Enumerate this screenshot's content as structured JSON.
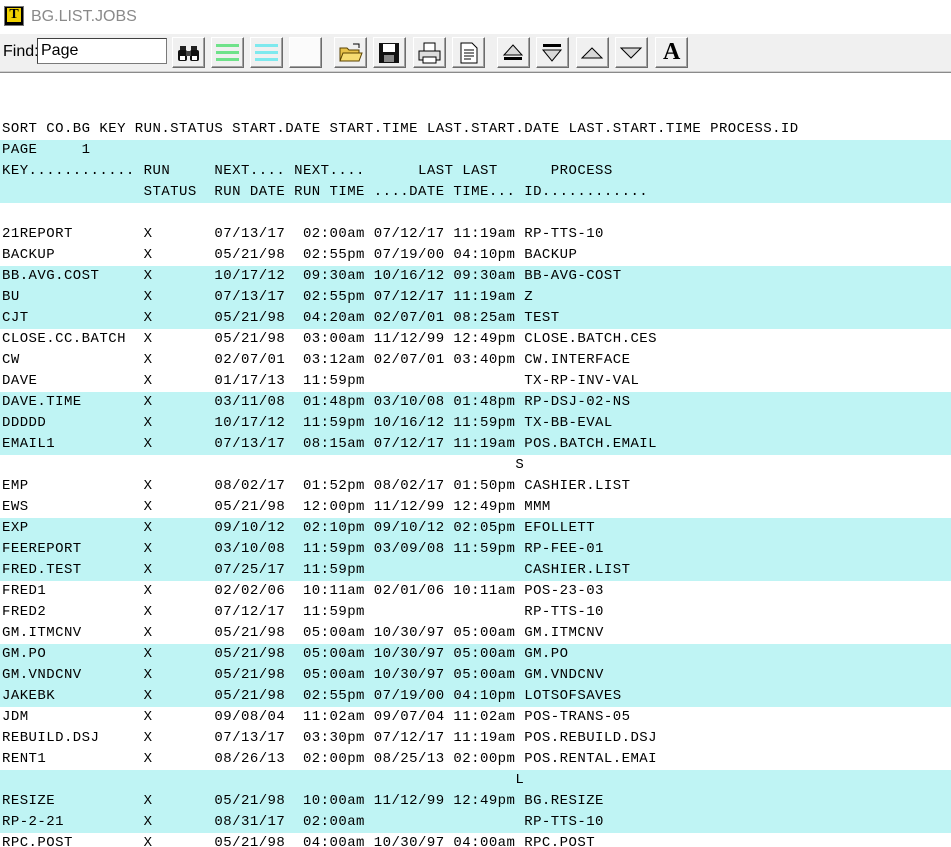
{
  "window": {
    "title": "BG.LIST.JOBS"
  },
  "toolbar": {
    "find_label": "Find:",
    "find_value": "Page",
    "buttons": [
      {
        "name": "binoculars-icon"
      },
      {
        "name": "green-lines-icon",
        "color": "#6fe28a"
      },
      {
        "name": "cyan-lines-icon",
        "color": "#7ee9ee"
      },
      {
        "name": "blank-icon"
      },
      {
        "name": "open-folder-icon"
      },
      {
        "name": "save-disk-icon"
      },
      {
        "name": "print-icon"
      },
      {
        "name": "document-icon"
      },
      {
        "name": "scroll-top-icon"
      },
      {
        "name": "scroll-bottom-icon"
      },
      {
        "name": "scroll-up-icon"
      },
      {
        "name": "scroll-down-icon"
      },
      {
        "name": "font-icon",
        "label": "A"
      }
    ]
  },
  "colors": {
    "band": "#bff4f4"
  },
  "report": {
    "lines": [
      {
        "text": "",
        "band": false
      },
      {
        "text": "",
        "band": false
      },
      {
        "text": "SORT CO.BG KEY RUN.STATUS START.DATE START.TIME LAST.START.DATE LAST.START.TIME PROCESS.ID",
        "band": false
      },
      {
        "text": "PAGE     1",
        "band": true
      },
      {
        "text": "KEY............ RUN     NEXT.... NEXT....      LAST LAST      PROCESS",
        "band": true
      },
      {
        "text": "                STATUS  RUN DATE RUN TIME ....DATE TIME... ID............",
        "band": true
      },
      {
        "text": "",
        "band": false
      },
      {
        "text": "21REPORT        X       07/13/17  02:00am 07/12/17 11:19am RP-TTS-10",
        "band": false
      },
      {
        "text": "BACKUP          X       05/21/98  02:55pm 07/19/00 04:10pm BACKUP",
        "band": false
      },
      {
        "text": "BB.AVG.COST     X       10/17/12  09:30am 10/16/12 09:30am BB-AVG-COST",
        "band": true
      },
      {
        "text": "BU              X       07/13/17  02:55pm 07/12/17 11:19am Z",
        "band": true
      },
      {
        "text": "CJT             X       05/21/98  04:20am 02/07/01 08:25am TEST",
        "band": true
      },
      {
        "text": "CLOSE.CC.BATCH  X       05/21/98  03:00am 11/12/99 12:49pm CLOSE.BATCH.CES",
        "band": false
      },
      {
        "text": "CW              X       02/07/01  03:12am 02/07/01 03:40pm CW.INTERFACE",
        "band": false
      },
      {
        "text": "DAVE            X       01/17/13  11:59pm                  TX-RP-INV-VAL",
        "band": false
      },
      {
        "text": "DAVE.TIME       X       03/11/08  01:48pm 03/10/08 01:48pm RP-DSJ-02-NS",
        "band": true
      },
      {
        "text": "DDDDD           X       10/17/12  11:59pm 10/16/12 11:59pm TX-BB-EVAL",
        "band": true
      },
      {
        "text": "EMAIL1          X       07/13/17  08:15am 07/12/17 11:19am POS.BATCH.EMAIL",
        "band": true
      },
      {
        "text": "                                                          S",
        "band": false
      },
      {
        "text": "EMP             X       08/02/17  01:52pm 08/02/17 01:50pm CASHIER.LIST",
        "band": false
      },
      {
        "text": "EWS             X       05/21/98  12:00pm 11/12/99 12:49pm MMM",
        "band": false
      },
      {
        "text": "EXP             X       09/10/12  02:10pm 09/10/12 02:05pm EFOLLETT",
        "band": true
      },
      {
        "text": "FEEREPORT       X       03/10/08  11:59pm 03/09/08 11:59pm RP-FEE-01",
        "band": true
      },
      {
        "text": "FRED.TEST       X       07/25/17  11:59pm                  CASHIER.LIST",
        "band": true
      },
      {
        "text": "FRED1           X       02/02/06  10:11am 02/01/06 10:11am POS-23-03",
        "band": false
      },
      {
        "text": "FRED2           X       07/12/17  11:59pm                  RP-TTS-10",
        "band": false
      },
      {
        "text": "GM.ITMCNV       X       05/21/98  05:00am 10/30/97 05:00am GM.ITMCNV",
        "band": false
      },
      {
        "text": "GM.PO           X       05/21/98  05:00am 10/30/97 05:00am GM.PO",
        "band": true
      },
      {
        "text": "GM.VNDCNV       X       05/21/98  05:00am 10/30/97 05:00am GM.VNDCNV",
        "band": true
      },
      {
        "text": "JAKEBK          X       05/21/98  02:55pm 07/19/00 04:10pm LOTSOFSAVES",
        "band": true
      },
      {
        "text": "JDM             X       09/08/04  11:02am 09/07/04 11:02am POS-TRANS-05",
        "band": false
      },
      {
        "text": "REBUILD.DSJ     X       07/13/17  03:30pm 07/12/17 11:19am POS.REBUILD.DSJ",
        "band": false
      },
      {
        "text": "RENT1           X       08/26/13  02:00pm 08/25/13 02:00pm POS.RENTAL.EMAI",
        "band": false
      },
      {
        "text": "                                                          L",
        "band": true
      },
      {
        "text": "RESIZE          X       05/21/98  10:00am 11/12/99 12:49pm BG.RESIZE",
        "band": true
      },
      {
        "text": "RP-2-21         X       08/31/17  02:00am                  RP-TTS-10",
        "band": true
      },
      {
        "text": "RPC.POST        X       05/21/98  04:00am 10/30/97 04:00am RPC.POST",
        "band": false
      }
    ]
  }
}
